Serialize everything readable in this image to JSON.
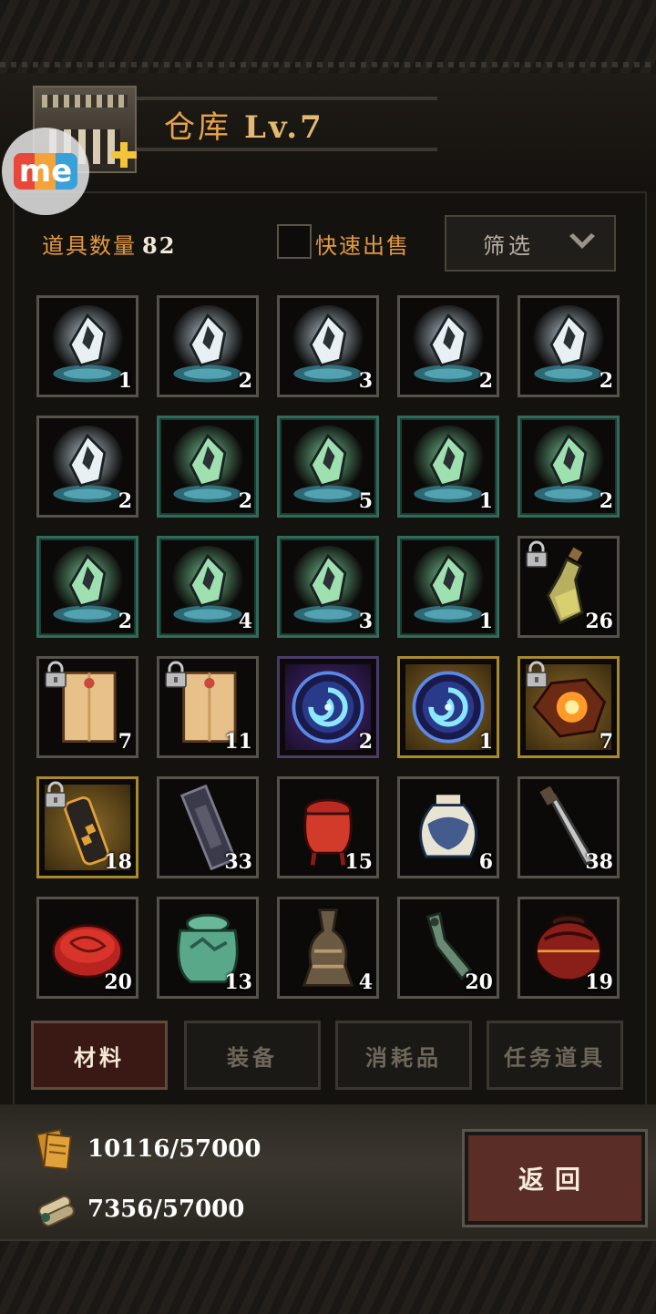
{
  "header": {
    "title": "仓库",
    "level": "Lv.7"
  },
  "me_badge": {
    "text": "me"
  },
  "toolbar": {
    "count_label": "道具数量",
    "count_value": "82",
    "quick_sell_label": "快速出售",
    "quick_sell_checked": false,
    "filter_label": "筛选"
  },
  "items": [
    {
      "kind": "crystal",
      "quality": "white",
      "qty": "1",
      "locked": false
    },
    {
      "kind": "crystal",
      "quality": "white",
      "qty": "2",
      "locked": false
    },
    {
      "kind": "crystal",
      "quality": "white",
      "qty": "3",
      "locked": false
    },
    {
      "kind": "crystal",
      "quality": "white",
      "qty": "2",
      "locked": false
    },
    {
      "kind": "crystal",
      "quality": "white",
      "qty": "2",
      "locked": false
    },
    {
      "kind": "crystal",
      "quality": "white",
      "qty": "2",
      "locked": false
    },
    {
      "kind": "crystal",
      "quality": "green",
      "qty": "2",
      "locked": false
    },
    {
      "kind": "crystal",
      "quality": "green",
      "qty": "5",
      "locked": false
    },
    {
      "kind": "crystal",
      "quality": "green",
      "qty": "1",
      "locked": false
    },
    {
      "kind": "crystal",
      "quality": "green",
      "qty": "2",
      "locked": false
    },
    {
      "kind": "crystal",
      "quality": "green",
      "qty": "2",
      "locked": false
    },
    {
      "kind": "crystal",
      "quality": "green",
      "qty": "4",
      "locked": false
    },
    {
      "kind": "crystal",
      "quality": "green",
      "qty": "3",
      "locked": false
    },
    {
      "kind": "crystal",
      "quality": "green",
      "qty": "1",
      "locked": false
    },
    {
      "kind": "bottle",
      "quality": "plain",
      "qty": "26",
      "locked": true
    },
    {
      "kind": "envelope",
      "quality": "plain",
      "qty": "7",
      "locked": true
    },
    {
      "kind": "envelope",
      "quality": "plain",
      "qty": "11",
      "locked": true
    },
    {
      "kind": "orb",
      "quality": "purple",
      "qty": "2",
      "locked": false
    },
    {
      "kind": "orb",
      "quality": "gold",
      "qty": "1",
      "locked": false
    },
    {
      "kind": "ember",
      "quality": "gold",
      "qty": "7",
      "locked": true
    },
    {
      "kind": "scroll",
      "quality": "gold",
      "qty": "18",
      "locked": true
    },
    {
      "kind": "plank",
      "quality": "plain",
      "qty": "33",
      "locked": false
    },
    {
      "kind": "red-vessel",
      "quality": "plain",
      "qty": "15",
      "locked": false
    },
    {
      "kind": "blue-jar",
      "quality": "plain",
      "qty": "6",
      "locked": false
    },
    {
      "kind": "blade",
      "quality": "plain",
      "qty": "38",
      "locked": false
    },
    {
      "kind": "lacquer-box",
      "quality": "plain",
      "qty": "20",
      "locked": false
    },
    {
      "kind": "jade-jar",
      "quality": "plain",
      "qty": "13",
      "locked": false
    },
    {
      "kind": "bronze-vase",
      "quality": "plain",
      "qty": "4",
      "locked": false
    },
    {
      "kind": "jade-hook",
      "quality": "plain",
      "qty": "20",
      "locked": false
    },
    {
      "kind": "lacquer-jar",
      "quality": "plain",
      "qty": "19",
      "locked": false
    }
  ],
  "tabs": [
    {
      "label": "材料",
      "active": true
    },
    {
      "label": "装备",
      "active": false
    },
    {
      "label": "消耗品",
      "active": false
    },
    {
      "label": "任务道具",
      "active": false
    }
  ],
  "resources": [
    {
      "icon": "paper-stack-icon",
      "text": "10116/57000"
    },
    {
      "icon": "scroll-bundle-icon",
      "text": "7356/57000"
    }
  ],
  "back_button": {
    "label": "返回"
  }
}
